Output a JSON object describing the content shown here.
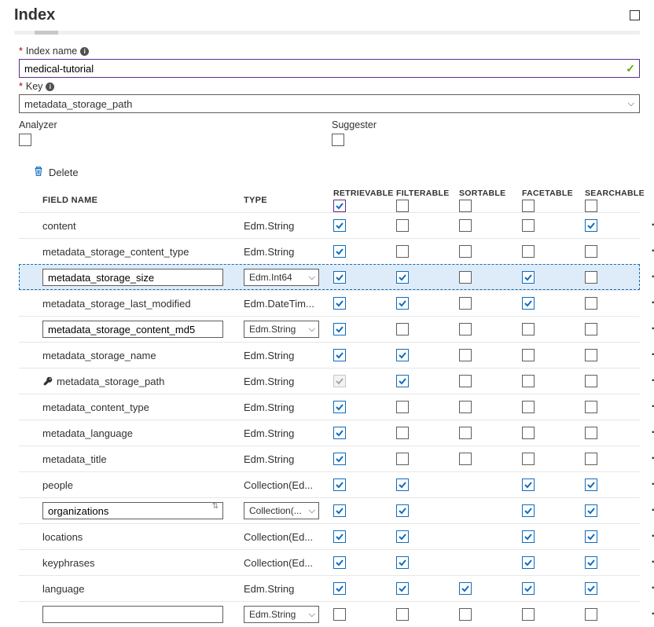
{
  "header": {
    "title": "Index"
  },
  "form": {
    "index_name_label": "Index name",
    "index_name_value": "medical-tutorial",
    "key_label": "Key",
    "key_value": "metadata_storage_path",
    "analyzer_label": "Analyzer",
    "suggester_label": "Suggester"
  },
  "toolbar": {
    "delete_label": "Delete"
  },
  "table": {
    "headers": {
      "field_name": "FIELD NAME",
      "type": "TYPE",
      "retrievable": "RETRIEVABLE",
      "filterable": "FILTERABLE",
      "sortable": "SORTABLE",
      "facetable": "FACETABLE",
      "searchable": "SEARCHABLE"
    },
    "header_checks": {
      "retrievable": true,
      "filterable": false,
      "sortable": false,
      "facetable": false,
      "searchable": false
    },
    "rows": [
      {
        "name": "content",
        "type": "Edm.String",
        "edit": false,
        "selected": false,
        "r": true,
        "f": false,
        "s": false,
        "fa": false,
        "se": true,
        "key": false,
        "rDisabled": false,
        "has_sortable": true,
        "has_facetable": true
      },
      {
        "name": "metadata_storage_content_type",
        "type": "Edm.String",
        "edit": false,
        "selected": false,
        "r": true,
        "f": false,
        "s": false,
        "fa": false,
        "se": false,
        "key": false,
        "rDisabled": false,
        "has_sortable": true,
        "has_facetable": true
      },
      {
        "name": "metadata_storage_size",
        "type": "Edm.Int64",
        "edit": true,
        "type_edit": true,
        "selected": true,
        "r": true,
        "f": true,
        "s": false,
        "fa": true,
        "se": false,
        "key": false,
        "rDisabled": false,
        "has_sortable": true,
        "has_facetable": true
      },
      {
        "name": "metadata_storage_last_modified",
        "type": "Edm.DateTim...",
        "edit": false,
        "selected": false,
        "r": true,
        "f": true,
        "s": false,
        "fa": true,
        "se": false,
        "key": false,
        "rDisabled": false,
        "has_sortable": true,
        "has_facetable": true
      },
      {
        "name": "metadata_storage_content_md5",
        "type": "Edm.String",
        "edit": true,
        "type_edit": true,
        "selected": false,
        "r": true,
        "f": false,
        "s": false,
        "fa": false,
        "se": false,
        "key": false,
        "rDisabled": false,
        "has_sortable": true,
        "has_facetable": true
      },
      {
        "name": "metadata_storage_name",
        "type": "Edm.String",
        "edit": false,
        "selected": false,
        "r": true,
        "f": true,
        "s": false,
        "fa": false,
        "se": false,
        "key": false,
        "rDisabled": false,
        "has_sortable": true,
        "has_facetable": true
      },
      {
        "name": "metadata_storage_path",
        "type": "Edm.String",
        "edit": false,
        "selected": false,
        "r": true,
        "f": true,
        "s": false,
        "fa": false,
        "se": false,
        "key": true,
        "rDisabled": true,
        "has_sortable": true,
        "has_facetable": true
      },
      {
        "name": "metadata_content_type",
        "type": "Edm.String",
        "edit": false,
        "selected": false,
        "r": true,
        "f": false,
        "s": false,
        "fa": false,
        "se": false,
        "key": false,
        "rDisabled": false,
        "has_sortable": true,
        "has_facetable": true
      },
      {
        "name": "metadata_language",
        "type": "Edm.String",
        "edit": false,
        "selected": false,
        "r": true,
        "f": false,
        "s": false,
        "fa": false,
        "se": false,
        "key": false,
        "rDisabled": false,
        "has_sortable": true,
        "has_facetable": true
      },
      {
        "name": "metadata_title",
        "type": "Edm.String",
        "edit": false,
        "selected": false,
        "r": true,
        "f": false,
        "s": false,
        "fa": false,
        "se": false,
        "key": false,
        "rDisabled": false,
        "has_sortable": true,
        "has_facetable": true
      },
      {
        "name": "people",
        "type": "Collection(Ed...",
        "edit": false,
        "selected": false,
        "r": true,
        "f": true,
        "s": false,
        "fa": true,
        "se": true,
        "key": false,
        "rDisabled": false,
        "has_sortable": false,
        "has_facetable": true
      },
      {
        "name": "organizations",
        "type": "Collection(...",
        "edit": true,
        "type_edit": true,
        "selected": false,
        "r": true,
        "f": true,
        "s": false,
        "fa": true,
        "se": true,
        "key": false,
        "rDisabled": false,
        "has_sortable": false,
        "has_facetable": true,
        "org": true
      },
      {
        "name": "locations",
        "type": "Collection(Ed...",
        "edit": false,
        "selected": false,
        "r": true,
        "f": true,
        "s": false,
        "fa": true,
        "se": true,
        "key": false,
        "rDisabled": false,
        "has_sortable": false,
        "has_facetable": true
      },
      {
        "name": "keyphrases",
        "type": "Collection(Ed...",
        "edit": false,
        "selected": false,
        "r": true,
        "f": true,
        "s": false,
        "fa": true,
        "se": true,
        "key": false,
        "rDisabled": false,
        "has_sortable": false,
        "has_facetable": true
      },
      {
        "name": "language",
        "type": "Edm.String",
        "edit": false,
        "selected": false,
        "r": true,
        "f": true,
        "s": true,
        "fa": true,
        "se": true,
        "key": false,
        "rDisabled": false,
        "has_sortable": true,
        "has_facetable": true
      },
      {
        "name": "",
        "type": "Edm.String",
        "edit": true,
        "type_edit": true,
        "selected": false,
        "r": false,
        "f": false,
        "s": false,
        "fa": false,
        "se": false,
        "key": false,
        "rDisabled": false,
        "has_sortable": true,
        "has_facetable": true
      }
    ]
  }
}
